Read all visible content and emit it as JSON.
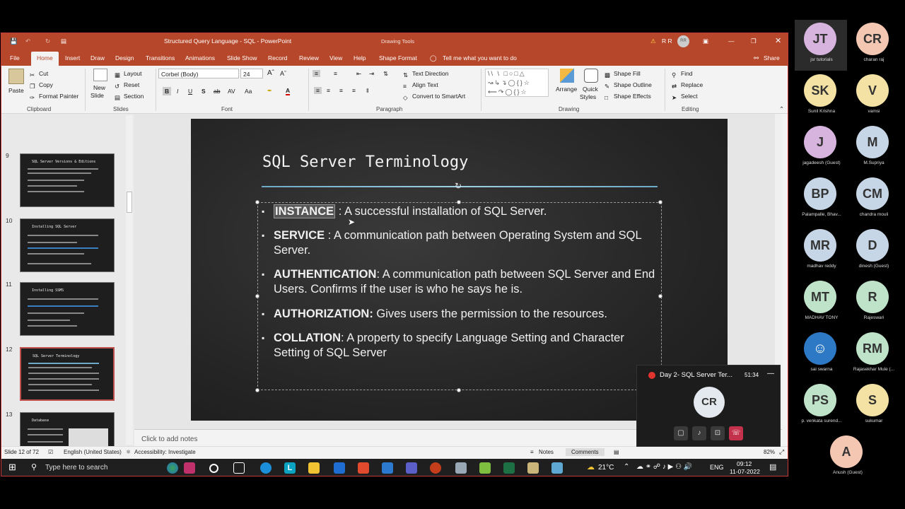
{
  "app": {
    "title": "Structured Query Language - SQL - PowerPoint",
    "drawing_tools": "Drawing Tools",
    "user": "R R",
    "user_initials": "RR",
    "share": "Share"
  },
  "tabs": [
    "File",
    "Home",
    "Insert",
    "Draw",
    "Design",
    "Transitions",
    "Animations",
    "Slide Show",
    "Record",
    "Review",
    "View",
    "Help",
    "Shape Format"
  ],
  "tell_me": "Tell me what you want to do",
  "ribbon": {
    "clipboard": {
      "paste": "Paste",
      "cut": "Cut",
      "copy": "Copy",
      "format_painter": "Format Painter",
      "group": "Clipboard"
    },
    "slides": {
      "new_slide_1": "New",
      "new_slide_2": "Slide",
      "layout": "Layout",
      "reset": "Reset",
      "section": "Section",
      "group": "Slides"
    },
    "font": {
      "name": "Corbel (Body)",
      "size": "24",
      "group": "Font"
    },
    "paragraph": {
      "text_direction": "Text Direction",
      "align_text": "Align Text",
      "convert": "Convert to SmartArt",
      "group": "Paragraph"
    },
    "drawing": {
      "arrange": "Arrange",
      "quick_styles_1": "Quick",
      "quick_styles_2": "Styles",
      "shape_fill": "Shape Fill",
      "shape_outline": "Shape Outline",
      "shape_effects": "Shape Effects",
      "group": "Drawing"
    },
    "editing": {
      "find": "Find",
      "replace": "Replace",
      "select": "Select",
      "group": "Editing"
    }
  },
  "thumbnails": [
    {
      "num": "9",
      "title": "SQL Server Versions & Editions"
    },
    {
      "num": "10",
      "title": "Installing SQL Server"
    },
    {
      "num": "11",
      "title": "Installing SSMS"
    },
    {
      "num": "12",
      "title": "SQL Server Terminology"
    },
    {
      "num": "13",
      "title": "Database"
    }
  ],
  "slide": {
    "title": "SQL Server Terminology",
    "bullets": [
      {
        "term": "INSTANCE",
        "text": " : A successful installation of SQL Server."
      },
      {
        "term": "SERVICE",
        "text": " : A communication path between Operating System and SQL Server."
      },
      {
        "term": "AUTHENTICATION",
        "text": ":  A communication path between SQL Server and End Users.  Confirms if the user is who he says he is."
      },
      {
        "term": "AUTHORIZATION:",
        "text": " Gives users the permission to the resources."
      },
      {
        "term": "COLLATION",
        "text": ":  A property to specify Language Setting and Character Setting of SQL Server"
      }
    ]
  },
  "notes_placeholder": "Click to add notes",
  "status": {
    "slide": "Slide 12 of 72",
    "language": "English (United States)",
    "accessibility": "Accessibility: Investigate",
    "notes": "Notes",
    "comments": "Comments",
    "zoom": "82%"
  },
  "taskbar": {
    "search": "Type here to search",
    "weather": "21°C",
    "lang": "ENG",
    "time": "09:12",
    "date": "11-07-2022"
  },
  "meeting_mini": {
    "title": "Day 2- SQL Server Ter...",
    "elapsed": "51:34",
    "speaker_initials": "CR"
  },
  "participants": [
    {
      "initials": "JT",
      "name": "jsr tutorials",
      "color": "#d7b4de"
    },
    {
      "initials": "CR",
      "name": "charan raj",
      "color": "#f4c7b3"
    },
    {
      "initials": "SK",
      "name": "Sunil Krishna",
      "color": "#f3e2a3"
    },
    {
      "initials": "V",
      "name": "vamsi",
      "color": "#f3e2a3"
    },
    {
      "initials": "J",
      "name": "jagadeesh (Guest)",
      "color": "#d7b4de"
    },
    {
      "initials": "M",
      "name": "M.Supriya",
      "color": "#c7d6e6"
    },
    {
      "initials": "BP",
      "name": "Palampalle, Bhav...",
      "color": "#c7d6e6"
    },
    {
      "initials": "CM",
      "name": "chandra mouli",
      "color": "#c7d6e6"
    },
    {
      "initials": "MR",
      "name": "madhav reddy",
      "color": "#c7d6e6"
    },
    {
      "initials": "D",
      "name": "dinesh (Guest)",
      "color": "#c7d6e6"
    },
    {
      "initials": "MT",
      "name": "MADHAV TONY",
      "color": "#bfe3c8"
    },
    {
      "initials": "R",
      "name": "Rajeswari",
      "color": "#bfe3c8"
    },
    {
      "initials": "",
      "name": "sai swarna",
      "color": "#2e79c6"
    },
    {
      "initials": "RM",
      "name": "Rajasekhar Mule (...",
      "color": "#bfe3c8"
    },
    {
      "initials": "PS",
      "name": "p. venkata surend...",
      "color": "#bfe3c8"
    },
    {
      "initials": "S",
      "name": "sukumar",
      "color": "#f3e2a3"
    },
    {
      "initials": "A",
      "name": "Anush (Guest)",
      "color": "#f4c7b3"
    }
  ]
}
